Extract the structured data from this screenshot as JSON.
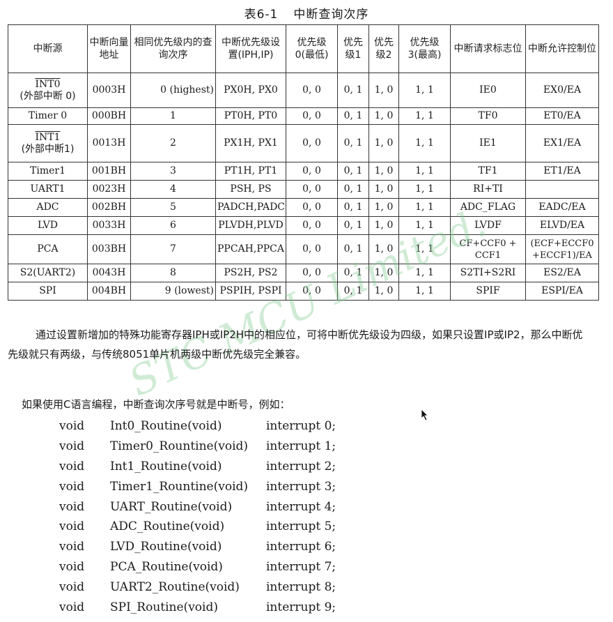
{
  "title": {
    "number": "表6-1",
    "text": "中断查询次序"
  },
  "table": {
    "headers": [
      "中断源",
      "中断向量地址",
      "相同优先级内的查询次序",
      "中断优先级设置(IPH,IP)",
      "优先级0(最低)",
      "优先级1",
      "优先级2",
      "优先级3(最高)",
      "中断请求标志位",
      "中断允许控制位"
    ],
    "rows": [
      {
        "source": "INT0",
        "source_sub": "(外部中断 0)",
        "addr": "0003H",
        "order": "0 (highest)",
        "prio": "PX0H, PX0",
        "p0": "0, 0",
        "p1": "0, 1",
        "p2": "1, 0",
        "p3": "1, 1",
        "flag": "IE0",
        "enable": "EX0/EA"
      },
      {
        "source": "Timer 0",
        "source_sub": "",
        "addr": "000BH",
        "order": "1",
        "prio": "PT0H, PT0",
        "p0": "0, 0",
        "p1": "0, 1",
        "p2": "1, 0",
        "p3": "1, 1",
        "flag": "TF0",
        "enable": "ET0/EA"
      },
      {
        "source": "INT1",
        "source_sub": "(外部中断1)",
        "addr": "0013H",
        "order": "2",
        "prio": "PX1H, PX1",
        "p0": "0, 0",
        "p1": "0, 1",
        "p2": "1, 0",
        "p3": "1, 1",
        "flag": "IE1",
        "enable": "EX1/EA"
      },
      {
        "source": "Timer1",
        "source_sub": "",
        "addr": "001BH",
        "order": "3",
        "prio": "PT1H, PT1",
        "p0": "0, 0",
        "p1": "0, 1",
        "p2": "1, 0",
        "p3": "1, 1",
        "flag": "TF1",
        "enable": "ET1/EA"
      },
      {
        "source": "UART1",
        "source_sub": "",
        "addr": "0023H",
        "order": "4",
        "prio": "PSH, PS",
        "p0": "0, 0",
        "p1": "0, 1",
        "p2": "1, 0",
        "p3": "1, 1",
        "flag": "RI+TI",
        "enable": ""
      },
      {
        "source": "ADC",
        "source_sub": "",
        "addr": "002BH",
        "order": "5",
        "prio": "PADCH,PADC",
        "p0": "0, 0",
        "p1": "0, 1",
        "p2": "1, 0",
        "p3": "1, 1",
        "flag": "ADC_FLAG",
        "enable": "EADC/EA"
      },
      {
        "source": "LVD",
        "source_sub": "",
        "addr": "0033H",
        "order": "6",
        "prio": "PLVDH,PLVD",
        "p0": "0, 0",
        "p1": "0, 1",
        "p2": "1, 0",
        "p3": "1, 1",
        "flag": "LVDF",
        "enable": "ELVD/EA"
      },
      {
        "source": "PCA",
        "source_sub": "",
        "addr": "003BH",
        "order": "7",
        "prio": "PPCAH,PPCA",
        "p0": "0, 0",
        "p1": "0, 1",
        "p2": "1, 0",
        "p3": "1, 1",
        "flag": "CF+CCF0 + CCF1",
        "enable": "(ECF+ECCF0 +ECCF1)/EA"
      },
      {
        "source": "S2(UART2)",
        "source_sub": "",
        "addr": "0043H",
        "order": "8",
        "prio": "PS2H, PS2",
        "p0": "0, 0",
        "p1": "0, 1",
        "p2": "1, 0",
        "p3": "1, 1",
        "flag": "S2TI+S2RI",
        "enable": "ES2/EA"
      },
      {
        "source": "SPI",
        "source_sub": "",
        "addr": "004BH",
        "order": "9 (lowest)",
        "prio": "PSPIH, PSPI",
        "p0": "0, 0",
        "p1": "0, 1",
        "p2": "1, 0",
        "p3": "1, 1",
        "flag": "SPIF",
        "enable": "ESPI/EA"
      }
    ]
  },
  "watermark": "STC MCU Limited.",
  "paragraphs": [
    "通过设置新增加的特殊功能寄存器IPH或IP2H中的相应位，可将中断优先级设为四级，如果只设置IP或IP2，那么中断优先级就只有两级，与传统8051单片机两级中断优先级完全兼容。",
    "如果使用C语言编程，中断查询次序号就是中断号，例如："
  ],
  "code": [
    {
      "type": "void",
      "name": "Int0_Routine(void)",
      "irq": "interrupt 0;"
    },
    {
      "type": "void",
      "name": "Timer0_Rountine(void)",
      "irq": "interrupt 1;"
    },
    {
      "type": "void",
      "name": "Int1_Routine(void)",
      "irq": "interrupt 2;"
    },
    {
      "type": "void",
      "name": "Timer1_Rountine(void)",
      "irq": "interrupt 3;"
    },
    {
      "type": "void",
      "name": "UART_Routine(void)",
      "irq": "interrupt 4;"
    },
    {
      "type": "void",
      "name": "ADC_Routine(void)",
      "irq": "interrupt 5;"
    },
    {
      "type": "void",
      "name": "LVD_Routine(void)",
      "irq": "interrupt 6;"
    },
    {
      "type": "void",
      "name": "PCA_Routine(void)",
      "irq": "interrupt 7;"
    },
    {
      "type": "void",
      "name": "UART2_Routine(void)",
      "irq": "interrupt 8;"
    },
    {
      "type": "void",
      "name": "SPI_Routine(void)",
      "irq": "interrupt 9;"
    }
  ],
  "cursor_icon": "mouse-pointer-icon"
}
